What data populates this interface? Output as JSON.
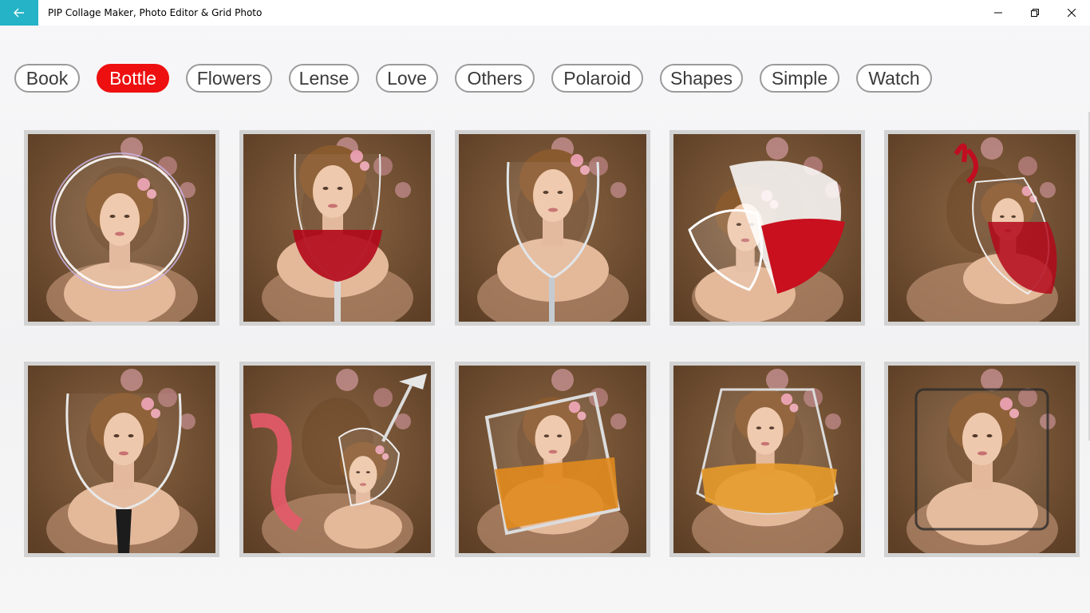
{
  "window": {
    "title": "PIP Collage Maker, Photo Editor & Grid Photo",
    "accent": "#24b3c7",
    "back_icon": "arrow-left-icon",
    "controls": [
      "minimize-icon",
      "restore-icon",
      "close-icon"
    ]
  },
  "categories": {
    "active_color": "#ee0f10",
    "items": [
      {
        "label": "Book",
        "active": false
      },
      {
        "label": "Bottle",
        "active": true
      },
      {
        "label": "Flowers",
        "active": false
      },
      {
        "label": "Lense",
        "active": false
      },
      {
        "label": "Love",
        "active": false
      },
      {
        "label": "Others",
        "active": false
      },
      {
        "label": "Polaroid",
        "active": false
      },
      {
        "label": "Shapes",
        "active": false
      },
      {
        "label": "Simple",
        "active": false
      },
      {
        "label": "Watch",
        "active": false
      }
    ]
  },
  "frames": [
    {
      "name": "bubble-frame"
    },
    {
      "name": "red-wine-glass-frame"
    },
    {
      "name": "empty-wine-glass-frame"
    },
    {
      "name": "heart-glass-frame"
    },
    {
      "name": "wine-splash-glass-frame"
    },
    {
      "name": "wide-wine-glass-frame"
    },
    {
      "name": "tilted-wine-splash-frame"
    },
    {
      "name": "tilted-whiskey-glass-frame"
    },
    {
      "name": "whiskey-glass-frame"
    },
    {
      "name": "square-glass-frame"
    }
  ]
}
